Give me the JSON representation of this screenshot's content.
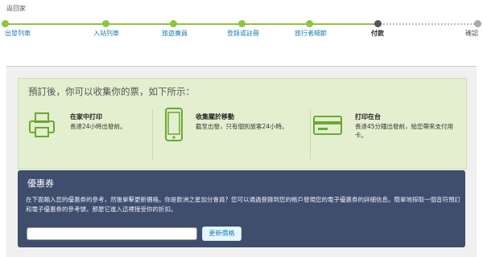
{
  "top_link": "返回家",
  "steps": [
    {
      "label": "出發列車",
      "state": "done"
    },
    {
      "label": "入站列車",
      "state": "done"
    },
    {
      "label": "旅遊廣員",
      "state": "done"
    },
    {
      "label": "登錄或註冊",
      "state": "done"
    },
    {
      "label": "旅行者細節",
      "state": "done"
    },
    {
      "label": "付款",
      "state": "current"
    },
    {
      "label": "確認",
      "state": "todo"
    }
  ],
  "collect": {
    "title": "預訂後，你可以收集你的票，如下所示：",
    "options": [
      {
        "icon": "printer-icon",
        "heading": "在家中打印",
        "desc": "長達24小時出發前。"
      },
      {
        "icon": "mobile-phone-icon",
        "heading": "收集關於移動",
        "desc": "截至出發，只有個別旅客24小時。"
      },
      {
        "icon": "ticket-card-icon",
        "heading": "打印在台",
        "desc": "長達45分鐘出發前，給您帶來支付用卡。"
      }
    ]
  },
  "coupon": {
    "title": "優惠券",
    "description": "在下面輸入您的優惠券的參考，然後單擊更新價格。你是歐洲之星加分會員？您可以通過登錄到您的帳戶發現您的電子優惠券的詳細信息。簡單地採取一個音符預訂和電子優惠券的參考號，那麼它進入這裡接受你的折扣。",
    "input_value": "",
    "button_label": "更新價格"
  },
  "colors": {
    "accent_green": "#8cc63f",
    "coupon_bg": "#3f4e6c",
    "panel_green": "#e3efcf",
    "link_blue": "#1a7fb5"
  }
}
